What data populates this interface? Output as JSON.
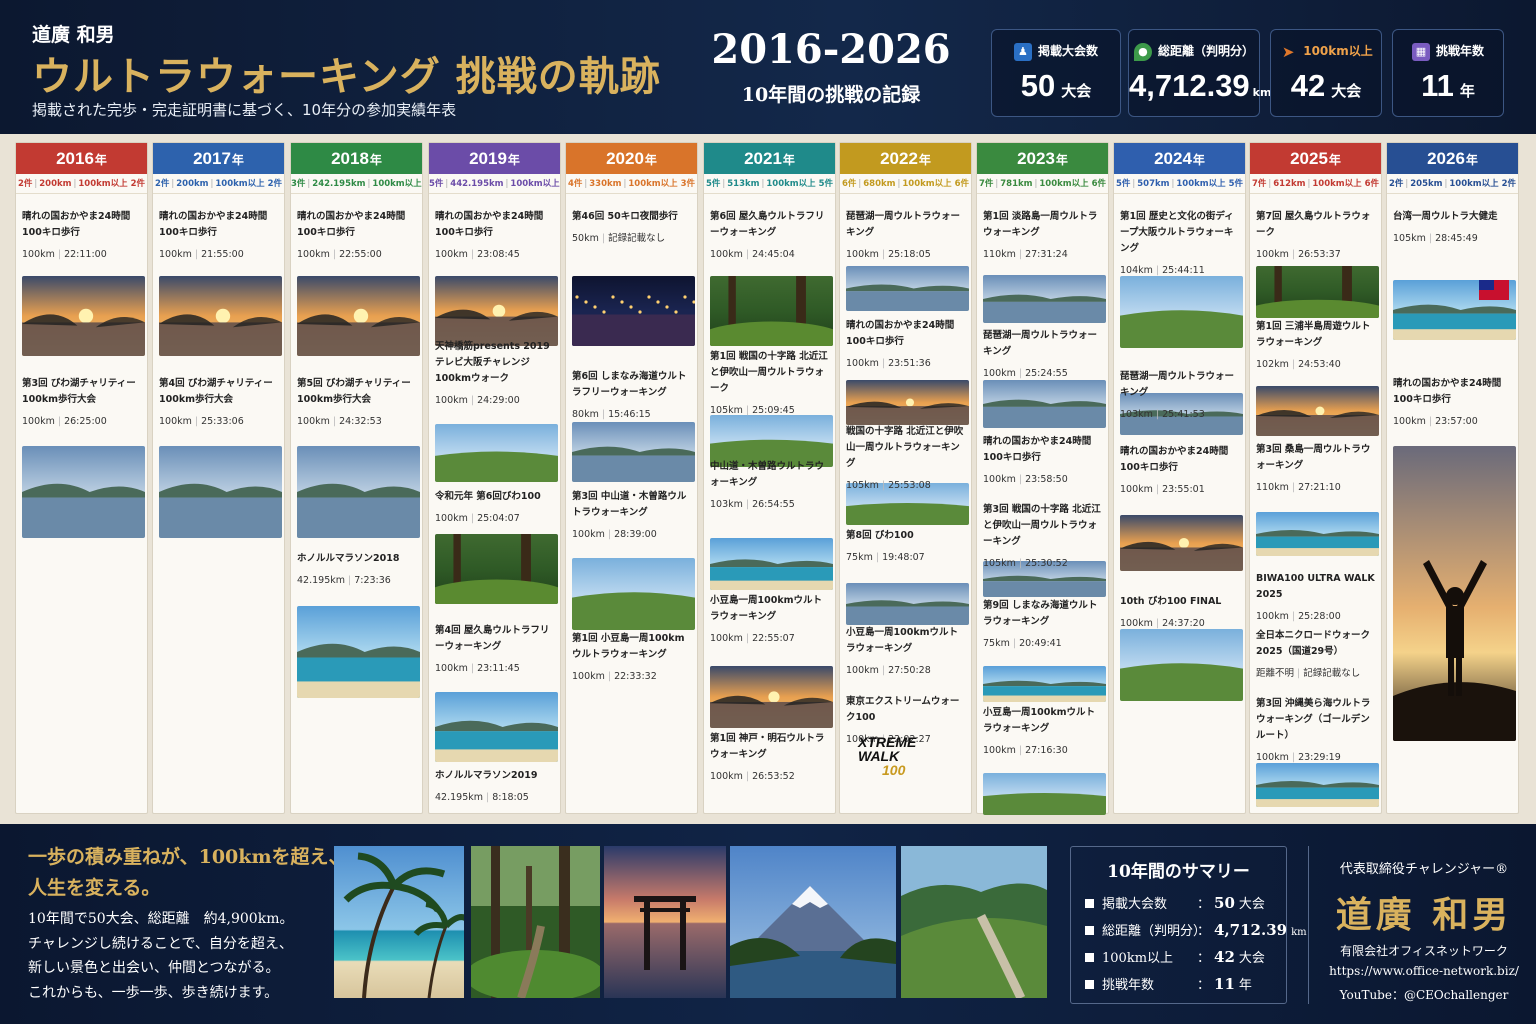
{
  "header": {
    "author": "道廣 和男",
    "title": "ウルトラウォーキング 挑戦の軌跡",
    "subtitle": "掲載された完歩・完走証明書に基づく、10年分の参加実績年表",
    "years": "2016-2026",
    "years_caption": "10年間の挑戦の記録"
  },
  "stats": [
    {
      "label": "掲載大会数",
      "value": "50",
      "unit": "大会",
      "icon": "walker-icon",
      "color": "#2a6fc4",
      "label_color": "#ffffff"
    },
    {
      "label": "総距離（判明分）",
      "value": "4,712.39",
      "unit": "km",
      "icon": "map-pin-icon",
      "color": "#3d9a4a",
      "label_color": "#ffffff"
    },
    {
      "label": "100km以上",
      "value": "42",
      "unit": "大会",
      "icon": "runner-icon",
      "color": "#e0782a",
      "label_color": "#f0a24a"
    },
    {
      "label": "挑戦年数",
      "value": "11",
      "unit": "年",
      "icon": "calendar-icon",
      "color": "#7a5cc0",
      "label_color": "#ffffff"
    }
  ],
  "year_suffix": "年",
  "timeline": [
    {
      "year": "2016",
      "color": "#c23a32",
      "stats": [
        "2件",
        "200km",
        "100km以上 2件"
      ],
      "events": [
        {
          "name": "晴れの国おかやま24時間100キロ歩行",
          "dist": "100km",
          "time": "22:11:00"
        },
        {
          "name": "第3回 びわ湖チャリティー100km歩行大会",
          "dist": "100km",
          "time": "26:25:00"
        }
      ]
    },
    {
      "year": "2017",
      "color": "#2d62ad",
      "stats": [
        "2件",
        "200km",
        "100km以上 2件"
      ],
      "events": [
        {
          "name": "晴れの国おかやま24時間100キロ歩行",
          "dist": "100km",
          "time": "21:55:00"
        },
        {
          "name": "第4回 びわ湖チャリティー100km歩行大会",
          "dist": "100km",
          "time": "25:33:06"
        }
      ]
    },
    {
      "year": "2018",
      "color": "#2e8a45",
      "stats": [
        "3件",
        "242.195km",
        "100km以上 3件"
      ],
      "events": [
        {
          "name": "晴れの国おかやま24時間100キロ歩行",
          "dist": "100km",
          "time": "22:55:00"
        },
        {
          "name": "第5回 びわ湖チャリティー100km歩行大会",
          "dist": "100km",
          "time": "24:32:53"
        },
        {
          "name": "ホノルルマラソン2018",
          "dist": "42.195km",
          "time": "7:23:36"
        }
      ]
    },
    {
      "year": "2019",
      "color": "#6b4ca8",
      "stats": [
        "5件",
        "442.195km",
        "100km以上 5件"
      ],
      "events": [
        {
          "name": "晴れの国おかやま24時間100キロ歩行",
          "dist": "100km",
          "time": "23:08:45"
        },
        {
          "name": "天神橋筋presents 2019テレビ大阪チャレンジ100kmウォーク",
          "dist": "100km",
          "time": "24:29:00"
        },
        {
          "name": "令和元年 第6回びわ100",
          "dist": "100km",
          "time": "25:04:07"
        },
        {
          "name": "第4回 屋久島ウルトラフリーウォーキング",
          "dist": "100km",
          "time": "23:11:45"
        },
        {
          "name": "ホノルルマラソン2019",
          "dist": "42.195km",
          "time": "8:18:05"
        }
      ]
    },
    {
      "year": "2020",
      "color": "#d9742a",
      "stats": [
        "4件",
        "330km",
        "100km以上 3件"
      ],
      "events": [
        {
          "name": "第46回 50キロ夜間歩行",
          "dist": "50km",
          "time": "記録記載なし"
        },
        {
          "name": "第6回 しまなみ海道ウルトラフリーウォーキング",
          "dist": "80km",
          "time": "15:46:15"
        },
        {
          "name": "第3回 中山道・木曽路ウルトラウォーキング",
          "dist": "100km",
          "time": "28:39:00"
        },
        {
          "name": "第1回 小豆島一周100kmウルトラウォーキング",
          "dist": "100km",
          "time": "22:33:32"
        }
      ]
    },
    {
      "year": "2021",
      "color": "#1f8a8a",
      "stats": [
        "5件",
        "513km",
        "100km以上 5件"
      ],
      "events": [
        {
          "name": "第6回 屋久島ウルトラフリーウォーキング",
          "dist": "100km",
          "time": "24:45:04"
        },
        {
          "name": "第1回 戦国の十字路 北近江と伊吹山一周ウルトラウォーク",
          "dist": "105km",
          "time": "25:09:45"
        },
        {
          "name": "中山道・木曽路ウルトラウォーキング",
          "dist": "103km",
          "time": "26:54:55"
        },
        {
          "name": "小豆島一周100kmウルトラウォーキング",
          "dist": "100km",
          "time": "22:55:07"
        },
        {
          "name": "第1回 神戸・明石ウルトラウォーキング",
          "dist": "100km",
          "time": "26:53:52"
        }
      ]
    },
    {
      "year": "2022",
      "color": "#c29a1f",
      "stats": [
        "6件",
        "680km",
        "100km以上 6件"
      ],
      "events": [
        {
          "name": "琵琶湖一周ウルトラウォーキング",
          "dist": "100km",
          "time": "25:18:05"
        },
        {
          "name": "晴れの国おかやま24時間100キロ歩行",
          "dist": "100km",
          "time": "23:51:36"
        },
        {
          "name": "戦国の十字路 北近江と伊吹山一周ウルトラウォーキング",
          "dist": "105km",
          "time": "25:53:08"
        },
        {
          "name": "第8回 びわ100",
          "dist": "75km",
          "time": "19:48:07"
        },
        {
          "name": "小豆島一周100kmウルトラウォーキング",
          "dist": "100km",
          "time": "27:50:28"
        },
        {
          "name": "東京エクストリームウォーク100",
          "dist": "100km",
          "time": "22:02:27"
        }
      ],
      "logo": {
        "line1": "XTREME",
        "line2": "WALK",
        "num": "100"
      }
    },
    {
      "year": "2023",
      "color": "#3a8a3f",
      "stats": [
        "7件",
        "781km",
        "100km以上 6件"
      ],
      "events": [
        {
          "name": "第1回 淡路島一周ウルトラウォーキング",
          "dist": "110km",
          "time": "27:31:24"
        },
        {
          "name": "琵琶湖一周ウルトラウォーキング",
          "dist": "100km",
          "time": "25:24:55"
        },
        {
          "name": "晴れの国おかやま24時間100キロ歩行",
          "dist": "100km",
          "time": "23:58:50"
        },
        {
          "name": "第3回 戦国の十字路 北近江と伊吹山一周ウルトラウォーキング",
          "dist": "105km",
          "time": "25:30:52"
        },
        {
          "name": "第9回 しまなみ海道ウルトラウォーキング",
          "dist": "75km",
          "time": "20:49:41"
        },
        {
          "name": "小豆島一周100kmウルトラウォーキング",
          "dist": "100km",
          "time": "27:16:30"
        }
      ]
    },
    {
      "year": "2024",
      "color": "#2f5fae",
      "stats": [
        "5件",
        "507km",
        "100km以上 5件"
      ],
      "events": [
        {
          "name": "第1回 歴史と文化の街ディープ大阪ウルトラウォーキング",
          "dist": "104km",
          "time": "25:44:11"
        },
        {
          "name": "琵琶湖一周ウルトラウォーキング",
          "dist": "103km",
          "time": "25:41:53"
        },
        {
          "name": "晴れの国おかやま24時間100キロ歩行",
          "dist": "100km",
          "time": "23:55:01"
        },
        {
          "name": "10th びわ100 FINAL",
          "dist": "100km",
          "time": "24:37:20"
        }
      ]
    },
    {
      "year": "2025",
      "color": "#c23a32",
      "stats": [
        "7件",
        "612km",
        "100km以上 6件"
      ],
      "events": [
        {
          "name": "第7回 屋久島ウルトラウォーク",
          "dist": "100km",
          "time": "26:53:37"
        },
        {
          "name": "第1回 三浦半島周遊ウルトラウォーキング",
          "dist": "102km",
          "time": "24:53:40"
        },
        {
          "name": "第3回 桑島一周ウルトラウォーキング",
          "dist": "110km",
          "time": "27:21:10"
        },
        {
          "name": "BIWA100 ULTRA WALK 2025",
          "dist": "100km",
          "time": "25:28:00"
        },
        {
          "name": "全日本ニクロードウォーク2025（国道29号）",
          "dist": "距離不明",
          "time": "記録記載なし"
        },
        {
          "name": "第3回 沖縄美ら海ウルトラウォーキング（ゴールデンルート）",
          "dist": "100km",
          "time": "23:29:19"
        }
      ]
    },
    {
      "year": "2026",
      "color": "#274f93",
      "stats": [
        "2件",
        "205km",
        "100km以上 2件"
      ],
      "events": [
        {
          "name": "台湾一周ウルトラ大健走",
          "dist": "105km",
          "time": "28:45:49"
        },
        {
          "name": "晴れの国おかやま24時間100キロ歩行",
          "dist": "100km",
          "time": "23:57:00"
        }
      ]
    }
  ],
  "footer": {
    "quote": [
      "一歩の積み重ねが、100kmを超え、",
      "人生を変える。"
    ],
    "body": [
      "10年間で50大会、総距離　約4,900km。",
      "チャレンジし続けることで、自分を超え、",
      "新しい景色と出会い、仲間とつながる。",
      "これからも、一歩一歩、歩き続けます。"
    ],
    "summary": {
      "title": "10年間のサマリー",
      "rows": [
        {
          "label": "掲載大会数",
          "value": "50",
          "unit": "大会"
        },
        {
          "label": "総距離（判明分）",
          "value": "4,712.39",
          "unit": "km"
        },
        {
          "label": "100km以上",
          "value": "42",
          "unit": "大会"
        },
        {
          "label": "挑戦年数",
          "value": "11",
          "unit": "年"
        }
      ]
    },
    "ceo": {
      "role": "代表取締役チャレンジャー®",
      "name": "道廣 和男",
      "company": "有限会社オフィスネットワーク",
      "url": "https://www.office-network.biz/",
      "youtube": "YouTube：@CEOchallenger"
    }
  }
}
